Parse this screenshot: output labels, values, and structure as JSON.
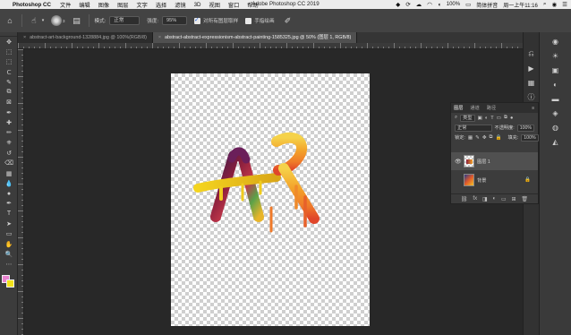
{
  "menubar": {
    "apple": "",
    "app": "Photoshop CC",
    "items": [
      "文件",
      "编辑",
      "图像",
      "图层",
      "文字",
      "选择",
      "滤镜",
      "3D",
      "视图",
      "窗口",
      "帮助"
    ],
    "window_title": "Adobe Photoshop CC 2019",
    "status": {
      "battery": "100%",
      "input_method": "简体拼音",
      "clock": "周一上午11:16"
    }
  },
  "options_bar": {
    "brush_size": "3",
    "mode_label": "模式:",
    "mode_value": "正常",
    "strength_label": "强度:",
    "strength_value": "95%",
    "sample_all_layers": "对所有图层取样",
    "finger_painting": "手指绘画"
  },
  "tabs": [
    {
      "label": "abstract-art-background-1328884.jpg @ 100%(RGB/8)",
      "close": "×",
      "active": false
    },
    {
      "label": "abstract-abstract-expressionism-abstract-painting-1585325.jpg @ 50% (图层 1, RGB/8)",
      "close": "×",
      "active": true
    }
  ],
  "toolbar": {
    "tools": [
      "move-tool",
      "artboard-tool",
      "marquee-tool",
      "lasso-tool",
      "quick-select-tool",
      "crop-tool",
      "frame-tool",
      "eyedropper-tool",
      "healing-brush-tool",
      "brush-tool",
      "clone-stamp-tool",
      "history-brush-tool",
      "eraser-tool",
      "gradient-tool",
      "blur-tool",
      "dodge-tool",
      "pen-tool",
      "type-tool",
      "path-select-tool",
      "rectangle-tool",
      "hand-tool",
      "zoom-tool",
      "more-tools-icon"
    ],
    "glyphs": [
      "✥",
      "⬚",
      "⬚",
      "ᑕ",
      "✎",
      "⧉",
      "⊠",
      "✒",
      "✚",
      "✏",
      "⎈",
      "↺",
      "⌫",
      "▦",
      "💧",
      "●",
      "✒",
      "T",
      "➤",
      "▭",
      "✋",
      "🔍",
      "⋯"
    ],
    "foreground_color": "#e883d0",
    "background_color": "#f2e21a"
  },
  "layers_panel": {
    "tabs": [
      "图层",
      "通道",
      "路径"
    ],
    "menu": "≡",
    "filter_label": "类型",
    "blend_mode": "正常",
    "opacity_label": "不透明度:",
    "opacity_value": "100%",
    "lock_label": "锁定:",
    "fill_label": "填充:",
    "fill_value": "100%",
    "layers": [
      {
        "name": "图层 1",
        "selected": true,
        "visible": true
      },
      {
        "name": "背景",
        "selected": false,
        "visible": false,
        "locked": true
      }
    ],
    "footer_icons": [
      "link-icon",
      "fx-icon",
      "mask-icon",
      "adjustment-icon",
      "group-icon",
      "new-layer-icon",
      "trash-icon"
    ],
    "footer_glyphs": [
      "⛓",
      "fx",
      "◨",
      "◐",
      "▭",
      "⊞",
      "🗑"
    ]
  },
  "right_panels": {
    "icons": [
      "history-icon",
      "play-icon",
      "glyph-icon",
      "info-icon",
      "adjustments-icon",
      "gradient-panel-icon",
      "layers-panel-icon",
      "channels-panel-icon",
      "paths-panel-icon"
    ]
  }
}
